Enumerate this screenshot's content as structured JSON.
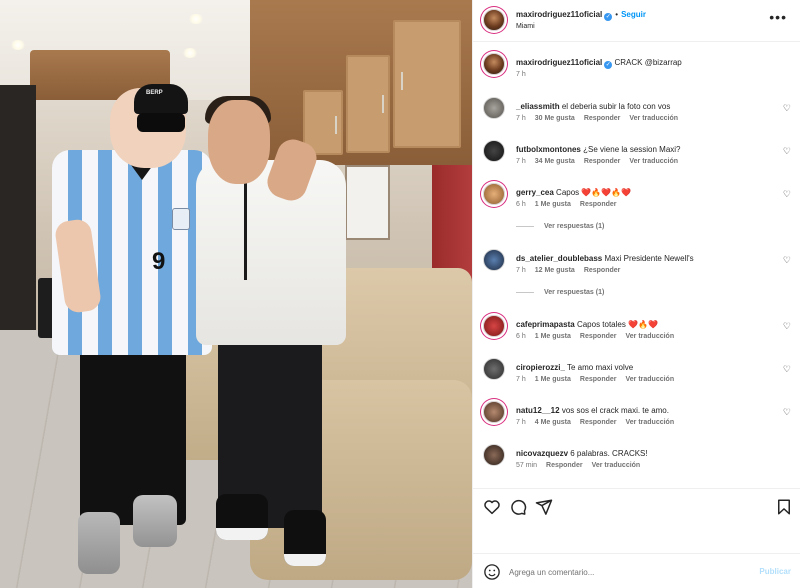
{
  "post": {
    "username": "maxirodriguez11oficial",
    "follow_label": "Seguir",
    "location": "Miami",
    "caption_username": "maxirodriguez11oficial",
    "caption_text": "CRACK @bizarrap",
    "caption_time": "7 h",
    "photo_cap_text": "BERP",
    "jersey_number": "9"
  },
  "comments": [
    {
      "user": "_eliassmith",
      "text": "el deberia subir la foto con vos",
      "time": "7 h",
      "likes": "30 Me gusta",
      "reply": "Responder",
      "translate": "Ver traducción"
    },
    {
      "user": "futbolxmontones",
      "text": "¿Se viene la session Maxi?",
      "time": "7 h",
      "likes": "34 Me gusta",
      "reply": "Responder",
      "translate": "Ver traducción"
    },
    {
      "user": "gerry_cea",
      "text": "Capos ❤️🔥❤️🔥❤️",
      "time": "6 h",
      "likes": "1 Me gusta",
      "reply": "Responder",
      "replies": "Ver respuestas (1)"
    },
    {
      "user": "ds_atelier_doublebass",
      "text": "Maxi Presidente Newell's",
      "time": "7 h",
      "likes": "12 Me gusta",
      "reply": "Responder",
      "replies": "Ver respuestas (1)"
    },
    {
      "user": "cafeprimapasta",
      "text": "Capos totales ❤️🔥❤️",
      "time": "6 h",
      "likes": "1 Me gusta",
      "reply": "Responder",
      "translate": "Ver traducción"
    },
    {
      "user": "ciropierozzi_",
      "text": "Te amo maxi volve",
      "time": "7 h",
      "likes": "1 Me gusta",
      "reply": "Responder",
      "translate": "Ver traducción"
    },
    {
      "user": "natu12__12",
      "text": "vos sos el crack maxi. te amo.",
      "time": "7 h",
      "likes": "4 Me gusta",
      "reply": "Responder",
      "translate": "Ver traducción"
    },
    {
      "user": "nicovazquezv",
      "text": "6 palabras. CRACKS!",
      "time": "57 min",
      "reply": "Responder",
      "translate": "Ver traducción"
    }
  ],
  "add_comment": {
    "placeholder": "Agrega un comentario...",
    "publish_label": "Publicar"
  },
  "icons": {
    "like": "heart-icon",
    "comment": "comment-icon",
    "share": "send-icon",
    "save": "bookmark-icon",
    "emoji": "emoji-icon",
    "more": "more-options-icon"
  },
  "colors": {
    "accent": "#0095f6",
    "verified": "#3897f0",
    "muted": "#737373"
  }
}
